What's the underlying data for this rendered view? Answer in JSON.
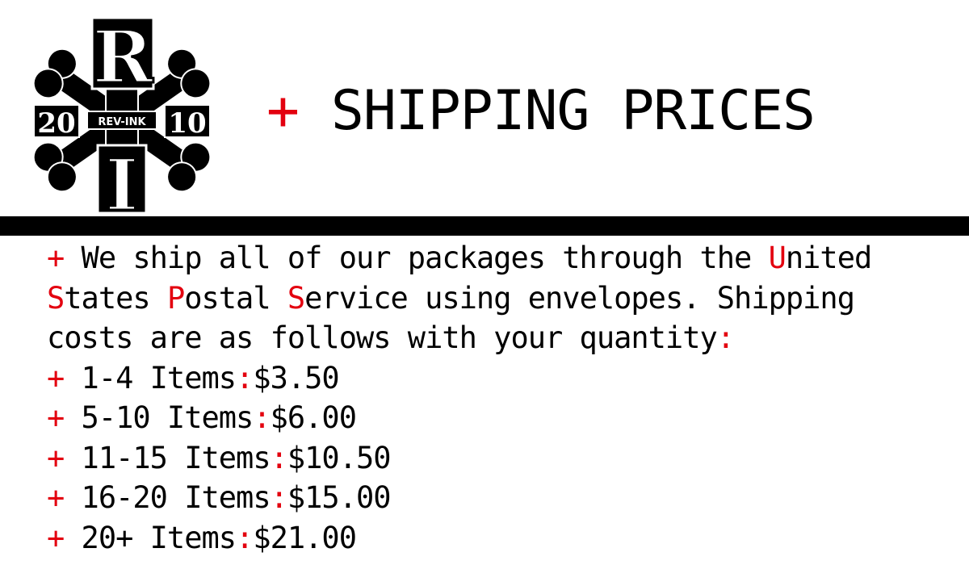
{
  "logo": {
    "letter_top": "R",
    "letter_bottom": "I",
    "year_left": "20",
    "year_right": "10",
    "banner": "REV-INK"
  },
  "header": {
    "plus": "+",
    "title": "SHIPPING PRICES"
  },
  "intro": {
    "plus": "+",
    "line1_text": " We ship all of our packages through the ",
    "u_letter": "U",
    "u_rest": "nited",
    "s1_letter": "S",
    "s1_rest": "tates ",
    "p_letter": "P",
    "p_rest": "ostal ",
    "s2_letter": "S",
    "s2_rest": "ervice using envelopes. Shipping",
    "line3_text": "costs are as follows with your quantity",
    "colon": ":"
  },
  "prices": [
    {
      "plus": "+",
      "range": " 1-4 Items",
      "colon": ":",
      "price": "$3.50"
    },
    {
      "plus": "+",
      "range": " 5-10 Items",
      "colon": ":",
      "price": "$6.00"
    },
    {
      "plus": "+",
      "range": " 11-15 Items",
      "colon": ":",
      "price": "$10.50"
    },
    {
      "plus": "+",
      "range": " 16-20 Items",
      "colon": ":",
      "price": "$15.00"
    },
    {
      "plus": "+",
      "range": " 20+ Items",
      "colon": ":",
      "price": "$21.00"
    }
  ],
  "colors": {
    "accent": "#e3000f",
    "text": "#000000",
    "background": "#ffffff"
  }
}
